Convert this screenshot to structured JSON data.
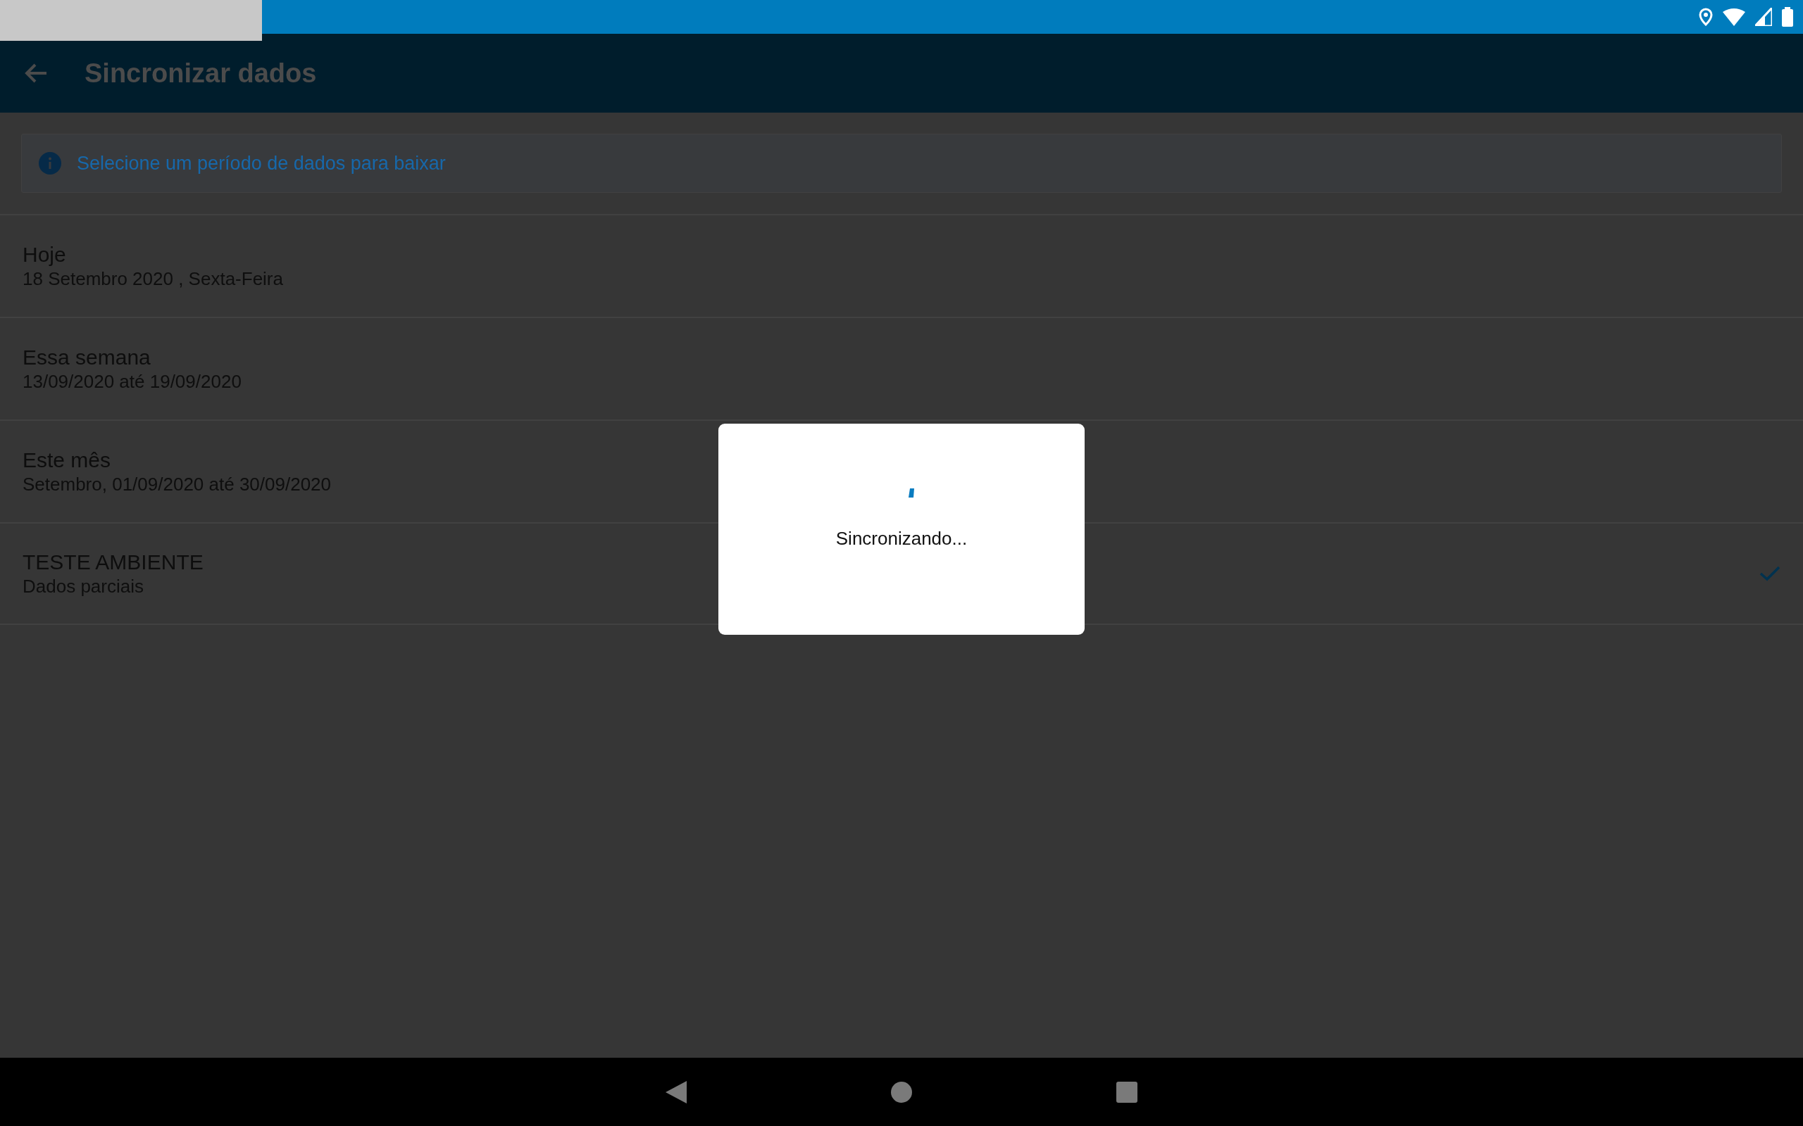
{
  "app_bar": {
    "title": "Sincronizar dados"
  },
  "info_banner": {
    "text": "Selecione um período de dados para baixar"
  },
  "periods": [
    {
      "title": "Hoje",
      "subtitle": "18 Setembro 2020 , Sexta-Feira",
      "selected": false
    },
    {
      "title": "Essa semana",
      "subtitle": "13/09/2020 até 19/09/2020",
      "selected": false
    },
    {
      "title": "Este mês",
      "subtitle": "Setembro, 01/09/2020 até 30/09/2020",
      "selected": false
    },
    {
      "title": "TESTE AMBIENTE",
      "subtitle": "Dados parciais",
      "selected": true
    }
  ],
  "dialog": {
    "message": "Sincronizando..."
  }
}
